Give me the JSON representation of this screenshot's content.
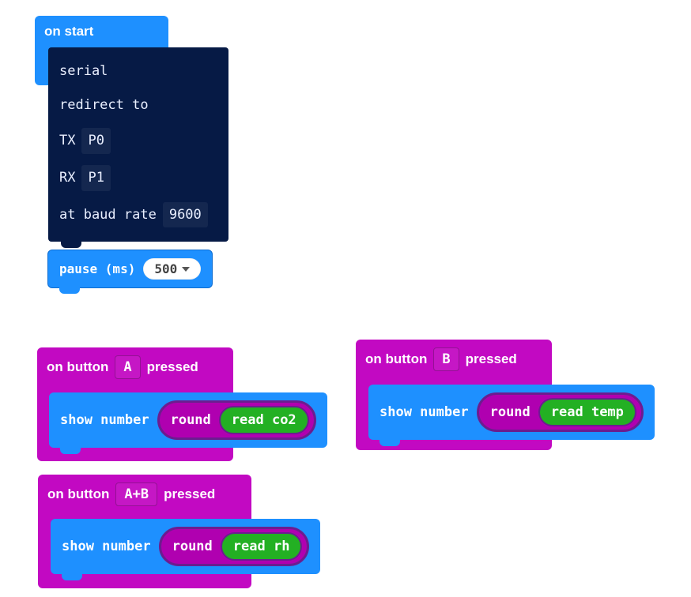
{
  "onstart": {
    "label": "on start",
    "serial": {
      "line1": "serial",
      "line2": "redirect to",
      "tx_label": "TX",
      "tx_value": "P0",
      "rx_label": "RX",
      "rx_value": "P1",
      "baud_label": "at baud rate",
      "baud_value": "9600"
    },
    "pause": {
      "label": "pause (ms)",
      "value": "500"
    }
  },
  "events": {
    "a": {
      "prefix": "on button",
      "button": "A",
      "suffix": "pressed",
      "show": "show number",
      "round": "round",
      "read": "read co2"
    },
    "b": {
      "prefix": "on button",
      "button": "B",
      "suffix": "pressed",
      "show": "show number",
      "round": "round",
      "read": "read temp"
    },
    "ab": {
      "prefix": "on button",
      "button": "A+B",
      "suffix": "pressed",
      "show": "show number",
      "round": "round",
      "read": "read rh"
    }
  }
}
